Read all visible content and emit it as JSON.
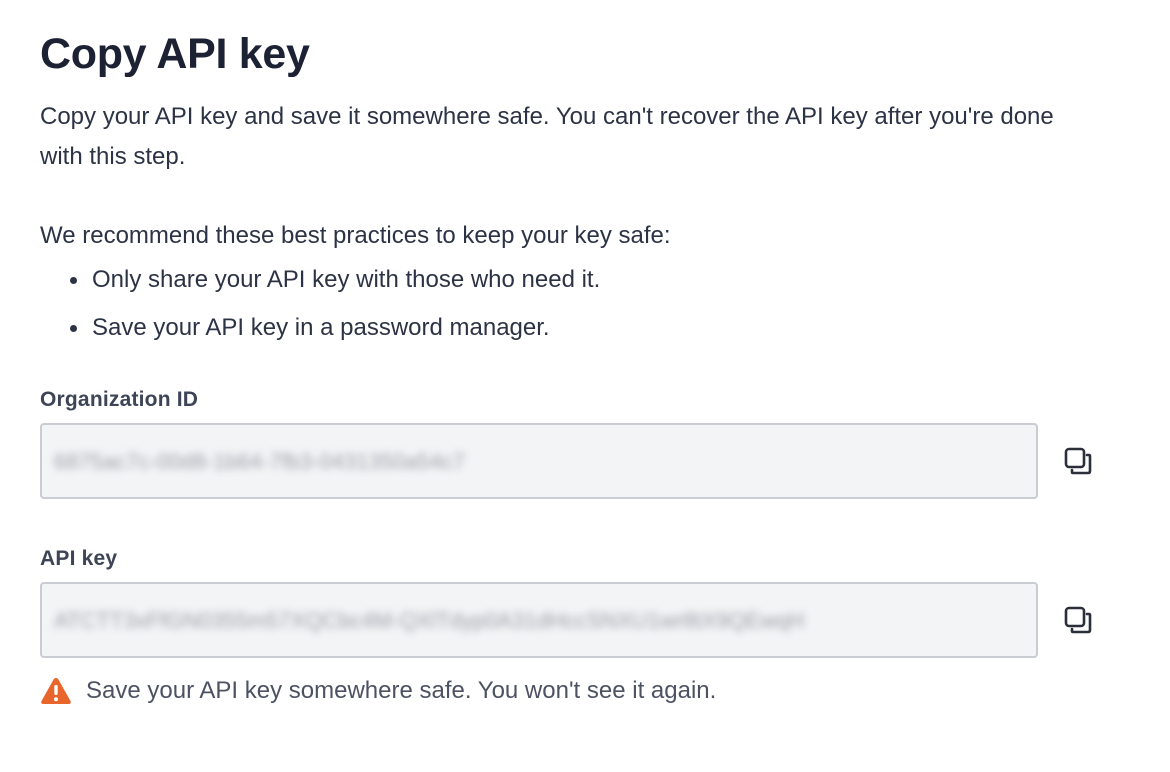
{
  "title": "Copy API key",
  "intro": "Copy your API key and save it somewhere safe. You can't recover the API key after you're done with this step.",
  "recommendation": "We recommend these best practices to keep your key safe:",
  "best_practices": [
    "Only share your API key with those who need it.",
    "Save your API key in a password manager."
  ],
  "organization_id": {
    "label": "Organization ID",
    "value": "6875ac7c-00d8-1b64-7fb3-0431350a54c7"
  },
  "api_key": {
    "label": "API key",
    "value": "ATCTT3xFfGN0355m57XQCbc4M-QXlTdyp0A31dHccSNXU1wr8tX9QEwqH"
  },
  "warning": {
    "text": "Save your API key somewhere safe. You won't see it again.",
    "icon": "warning-triangle-icon",
    "color": "#e8652b"
  },
  "colors": {
    "title": "#1c2233",
    "field_bg": "#f3f4f6",
    "field_border": "#c9ccd3"
  }
}
